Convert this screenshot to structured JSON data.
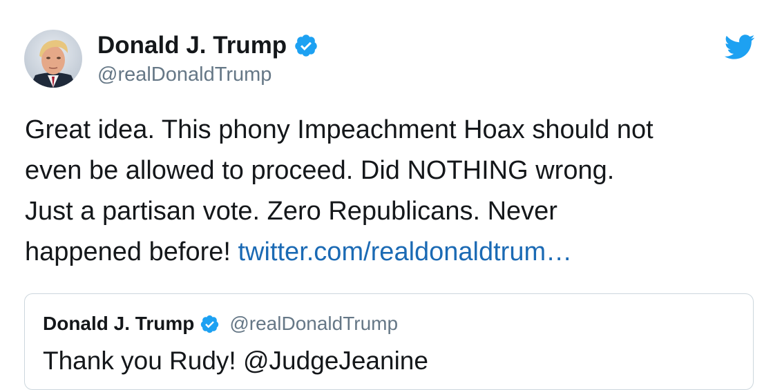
{
  "tweet": {
    "author": {
      "display_name": "Donald J. Trump",
      "handle": "@realDonaldTrump",
      "verified_icon": "verified-badge-icon",
      "avatar": "avatar-photo"
    },
    "brand_icon": "twitter-bird-icon",
    "text_lines": [
      "Great idea. This phony Impeachment Hoax should not",
      "even be allowed to proceed. Did NOTHING wrong.",
      "Just a partisan vote. Zero Republicans. Never",
      "happened before! "
    ],
    "link_text": "twitter.com/realdonaldtrum…",
    "quoted": {
      "display_name": "Donald J. Trump",
      "handle": "@realDonaldTrump",
      "text": "Thank you Rudy! @JudgeJeanine"
    }
  },
  "colors": {
    "text": "#14171a",
    "secondary_text": "#657786",
    "link": "#1b6ab4",
    "verified": "#1da1f2",
    "twitter_blue": "#1da1f2",
    "border": "#ccd6dd"
  }
}
